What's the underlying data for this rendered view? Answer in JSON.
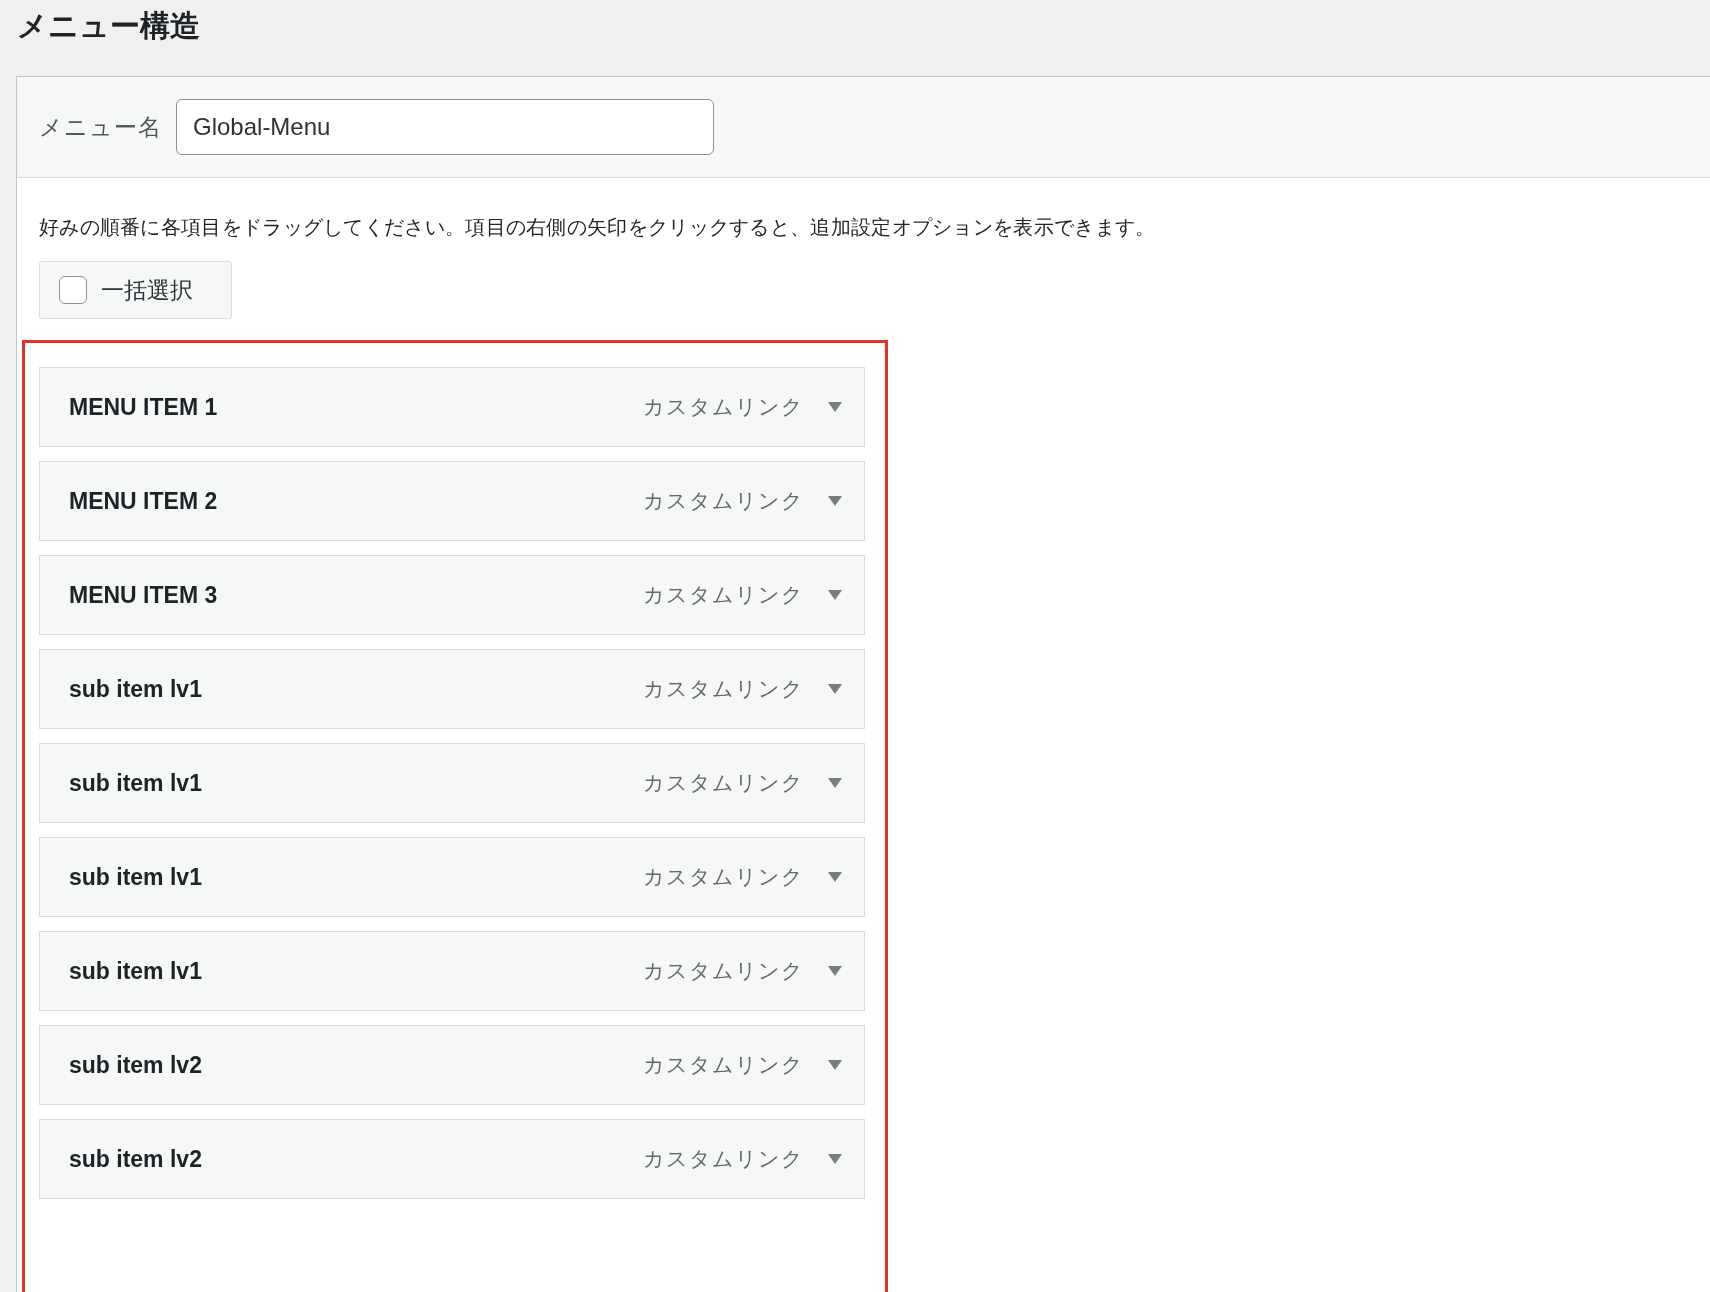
{
  "heading": "メニュー構造",
  "menu_name": {
    "label": "メニュー名",
    "value": "Global-Menu"
  },
  "instructions": "好みの順番に各項目をドラッグしてください。項目の右側の矢印をクリックすると、追加設定オプションを表示できます。",
  "bulk_select": {
    "label": "一括選択",
    "checked": false
  },
  "menu_items": [
    {
      "title": "MENU ITEM 1",
      "type": "カスタムリンク"
    },
    {
      "title": "MENU ITEM 2",
      "type": "カスタムリンク"
    },
    {
      "title": "MENU ITEM 3",
      "type": "カスタムリンク"
    },
    {
      "title": "sub item lv1",
      "type": "カスタムリンク"
    },
    {
      "title": "sub item lv1",
      "type": "カスタムリンク"
    },
    {
      "title": "sub item lv1",
      "type": "カスタムリンク"
    },
    {
      "title": "sub item lv1",
      "type": "カスタムリンク"
    },
    {
      "title": "sub item lv2",
      "type": "カスタムリンク"
    },
    {
      "title": "sub item lv2",
      "type": "カスタムリンク"
    }
  ]
}
